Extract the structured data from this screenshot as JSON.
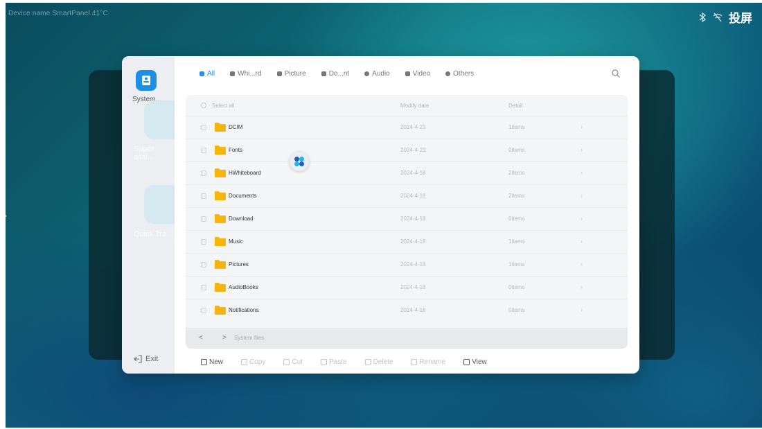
{
  "status_bar": {
    "device_info": "Device name   SmartPanel   41°C",
    "right_label": "投屏"
  },
  "sidebar": {
    "drive_label": "System...",
    "ghost_apps": [
      "Super assi...",
      "Quick Tra..."
    ],
    "exit_label": "Exit"
  },
  "tabs": [
    {
      "label": "All",
      "active": true
    },
    {
      "label": "Whi...rd",
      "active": false
    },
    {
      "label": "Picture",
      "active": false
    },
    {
      "label": "Do...nt",
      "active": false
    },
    {
      "label": "Audio",
      "active": false
    },
    {
      "label": "Video",
      "active": false
    },
    {
      "label": "Others",
      "active": false
    }
  ],
  "table": {
    "select_all": "Select all",
    "col_date": "Modify date",
    "col_detail": "Detail",
    "rows": [
      {
        "name": "DCIM",
        "date": "2024-4-23",
        "detail": "1items"
      },
      {
        "name": "Fonts",
        "date": "2024-4-23",
        "detail": "0items"
      },
      {
        "name": "HWhiteboard",
        "date": "2024-4-18",
        "detail": "2items"
      },
      {
        "name": "Documents",
        "date": "2024-4-18",
        "detail": "2items"
      },
      {
        "name": "Download",
        "date": "2024-4-18",
        "detail": "0items"
      },
      {
        "name": "Music",
        "date": "2024-4-18",
        "detail": "1items"
      },
      {
        "name": "Pictures",
        "date": "2024-4-18",
        "detail": "1items"
      },
      {
        "name": "AudioBooks",
        "date": "2024-4-18",
        "detail": "0items"
      },
      {
        "name": "Notifications",
        "date": "2024-4-18",
        "detail": "0items"
      }
    ]
  },
  "path_bar": {
    "back": "<",
    "separator": ">",
    "path": "System files"
  },
  "toolbar": {
    "new": "New",
    "copy": "Copy",
    "cut": "Cut",
    "paste": "Paste",
    "delete": "Delete",
    "rename": "Rename",
    "view": "View"
  },
  "colors": {
    "accent": "#2a8ee8",
    "folder": "#f5b50c",
    "drive_tile": "#1e8fe6"
  }
}
